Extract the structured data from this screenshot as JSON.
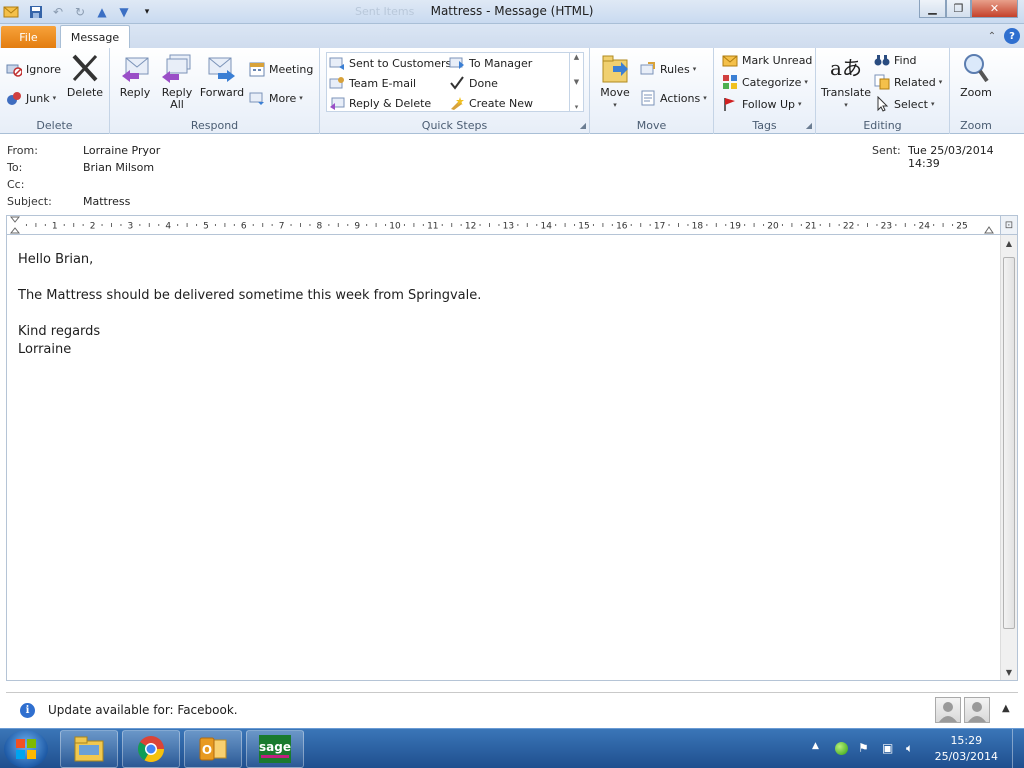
{
  "window": {
    "title": "Mattress  -  Message (HTML)",
    "faded_title_bg": "Sent Items"
  },
  "tabs": {
    "file": "File",
    "message": "Message"
  },
  "ribbon": {
    "delete_group": {
      "label": "Delete",
      "ignore": "Ignore",
      "junk": "Junk",
      "delete": "Delete"
    },
    "respond_group": {
      "label": "Respond",
      "reply": "Reply",
      "reply_all_1": "Reply",
      "reply_all_2": "All",
      "forward": "Forward",
      "meeting": "Meeting",
      "more": "More"
    },
    "quick_steps": {
      "label": "Quick Steps",
      "items": [
        "Sent to Customers",
        "To Manager",
        "Team E-mail",
        "Done",
        "Reply & Delete",
        "Create New"
      ]
    },
    "move_group": {
      "label": "Move",
      "move": "Move",
      "rules": "Rules",
      "actions": "Actions"
    },
    "tags_group": {
      "label": "Tags",
      "mark_unread": "Mark Unread",
      "categorize": "Categorize",
      "follow_up": "Follow Up"
    },
    "editing_group": {
      "label": "Editing",
      "translate": "Translate",
      "find": "Find",
      "related": "Related",
      "select": "Select"
    },
    "zoom_group": {
      "label": "Zoom",
      "zoom": "Zoom"
    }
  },
  "header": {
    "from_label": "From:",
    "from": "Lorraine Pryor",
    "to_label": "To:",
    "to": "Brian Milsom",
    "cc_label": "Cc:",
    "cc": "",
    "subject_label": "Subject:",
    "subject": "Mattress",
    "sent_label": "Sent:",
    "sent": "Tue 25/03/2014 14:39"
  },
  "ruler": {
    "numbers": [
      "1",
      "2",
      "3",
      "4",
      "5",
      "6",
      "7",
      "8",
      "9",
      "10",
      "11",
      "12",
      "13",
      "14",
      "15",
      "16",
      "17",
      "18",
      "19",
      "20",
      "21",
      "22",
      "23",
      "24",
      "25"
    ]
  },
  "body": {
    "line1": "Hello Brian,",
    "line2": "The Mattress should be delivered sometime this week from Springvale.",
    "line3": "Kind regards",
    "line4": "Lorraine"
  },
  "infobar": {
    "text": "Update available for: Facebook."
  },
  "taskbar": {
    "apps": [
      "explorer",
      "chrome",
      "outlook",
      "sage"
    ],
    "sage_label": "sage",
    "time": "15:29",
    "date": "25/03/2014"
  },
  "colors": {
    "file_tab": "#e37d10",
    "taskbar": "#1f4f8e"
  }
}
